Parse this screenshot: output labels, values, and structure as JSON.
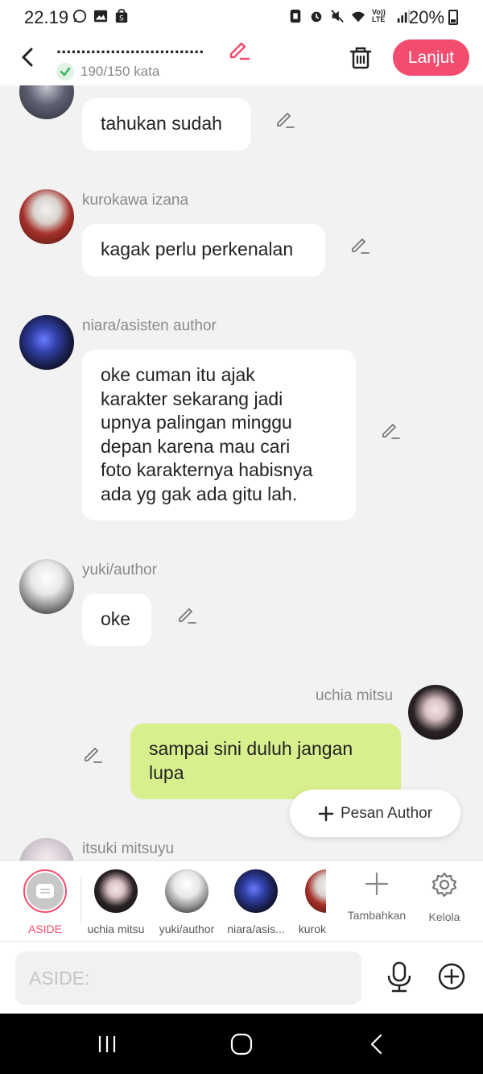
{
  "status_bar": {
    "time": "22.19",
    "battery": "20%",
    "left_icons": [
      "whatsapp-icon",
      "gallery-icon",
      "shop-icon"
    ],
    "right_icons": [
      "nfc-icon",
      "alarm-icon",
      "mute-icon",
      "wifi-icon",
      "volte-icon",
      "signal-icon",
      "battery-icon"
    ],
    "volte_label": "Vo)) LTE"
  },
  "header": {
    "title": "..............................",
    "word_count": "190/150 kata",
    "next_label": "Lanjut"
  },
  "colors": {
    "accent": "#f24d6e",
    "bubble_own": "#d7ef8d",
    "bubble_other": "#ffffff",
    "background": "#f2f2f2"
  },
  "messages": [
    {
      "sender": "",
      "text": "tahukan sudah",
      "side": "left",
      "avatar": "dark-hair-girl-avatar"
    },
    {
      "sender": "kurokawa izana",
      "text": "kagak perlu perkenalan",
      "side": "left",
      "avatar": "white-hair-boy-avatar"
    },
    {
      "sender": "niara/asisten author",
      "text": "oke cuman itu ajak\nkarakter sekarang jadi\nupnya palingan minggu\ndepan karena mau cari\nfoto karakternya habisnya\nada yg gak ada gitu lah.",
      "side": "left",
      "avatar": "blue-flame-avatar"
    },
    {
      "sender": "yuki/author",
      "text": "oke",
      "side": "left",
      "avatar": "white-hair-girl-avatar"
    },
    {
      "sender": "uchia mitsu",
      "text": "sampai sini duluh jangan\nlupa",
      "side": "right",
      "avatar": "black-hair-girl-avatar"
    },
    {
      "sender": "itsuki mitsuyu",
      "text": "",
      "side": "left",
      "avatar": "light-hair-girl-avatar"
    }
  ],
  "fab": {
    "label": "Pesan Author",
    "icon": "plus-icon"
  },
  "characters": [
    {
      "label": "ASIDE",
      "icon": "aside-icon"
    },
    {
      "label": "uchia mitsu"
    },
    {
      "label": "yuki/author"
    },
    {
      "label": "niara/asis..."
    },
    {
      "label": "kurok"
    }
  ],
  "tools": [
    {
      "label": "Tambahkan",
      "icon": "plus-icon"
    },
    {
      "label": "Kelola",
      "icon": "gear-icon"
    }
  ],
  "composer": {
    "placeholder": "ASIDE:"
  }
}
